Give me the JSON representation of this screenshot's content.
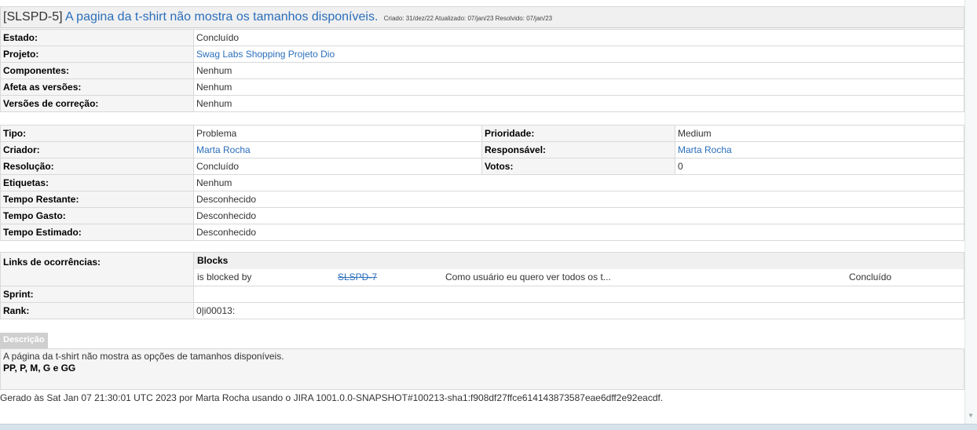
{
  "issue": {
    "key": "[SLSPD-5]",
    "summary": "A pagina da t-shirt não mostra os tamanhos disponíveis.",
    "meta": "Criado: 31/dez/22  Atualizado: 07/jan/23  Resolvido: 07/jan/23"
  },
  "details": [
    {
      "label": "Estado:",
      "value": "Concluído",
      "link": false
    },
    {
      "label": "Projeto:",
      "value": "Swag Labs Shopping Projeto Dio",
      "link": true
    },
    {
      "label": "Componentes:",
      "value": "Nenhum",
      "link": false
    },
    {
      "label": "Afeta as versões:",
      "value": "Nenhum",
      "link": false
    },
    {
      "label": "Versões de correção:",
      "value": "Nenhum",
      "link": false
    }
  ],
  "people": {
    "tipo_label": "Tipo:",
    "tipo": "Problema",
    "prioridade_label": "Prioridade:",
    "prioridade": "Medium",
    "criador_label": "Criador:",
    "criador": "Marta Rocha",
    "responsavel_label": "Responsável:",
    "responsavel": "Marta Rocha",
    "resolucao_label": "Resolução:",
    "resolucao": "Concluído",
    "votos_label": "Votos:",
    "votos": "0",
    "etiquetas_label": "Etiquetas:",
    "etiquetas": "Nenhum",
    "restante_label": "Tempo Restante:",
    "restante": "Desconhecido",
    "gasto_label": "Tempo Gasto:",
    "gasto": "Desconhecido",
    "estimado_label": "Tempo Estimado:",
    "estimado": "Desconhecido"
  },
  "links": {
    "label": "Links de ocorrências:",
    "group": "Blocks",
    "relation": "is blocked by",
    "linked_key": "SLSPD-7",
    "linked_summary": "Como usuário eu quero ver todos os t...",
    "linked_status": "Concluído",
    "sprint_label": "Sprint:",
    "sprint": "",
    "rank_label": "Rank:",
    "rank": "0|i00013:"
  },
  "description": {
    "tab": "Descrição",
    "line1": "A página da t-shirt não mostra as opções de tamanhos disponíveis.",
    "line2": "PP, P, M, G e GG"
  },
  "footer": "Gerado às Sat Jan 07 21:30:01 UTC 2023 por Marta Rocha usando o JIRA 1001.0.0-SNAPSHOT#100213-sha1:f908df27ffce614143873587eae6dff2e92eacdf."
}
